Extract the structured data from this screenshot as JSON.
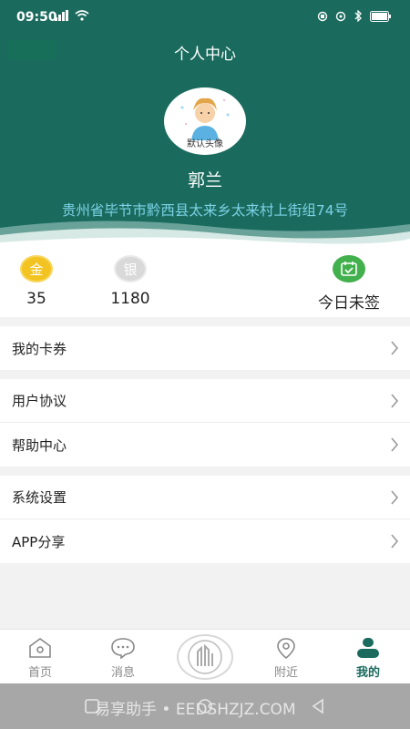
{
  "status_bar": {
    "time": "09:50"
  },
  "header": {
    "title": "个人中心",
    "avatar_caption": "默认头像",
    "user_name": "郭兰",
    "address": "贵州省毕节市黔西县太来乡太来村上街组74号"
  },
  "stats": {
    "gold": {
      "glyph": "金",
      "value": "35"
    },
    "silver": {
      "glyph": "银",
      "value": "1180"
    },
    "checkin": {
      "label": "今日未签"
    }
  },
  "menu": {
    "group1": [
      "我的卡券"
    ],
    "group2": [
      "用户协议",
      "帮助中心"
    ],
    "group3": [
      "系统设置",
      "APP分享"
    ]
  },
  "nav": {
    "home": "首页",
    "messages": "消息",
    "nearby": "附近",
    "mine": "我的"
  },
  "watermark": "易享助手 • EEDSHZJZ.COM",
  "colors": {
    "primary": "#1a6b5e",
    "address": "#7cd2e6",
    "gold": "#f3c322",
    "checkin": "#43b04e"
  }
}
